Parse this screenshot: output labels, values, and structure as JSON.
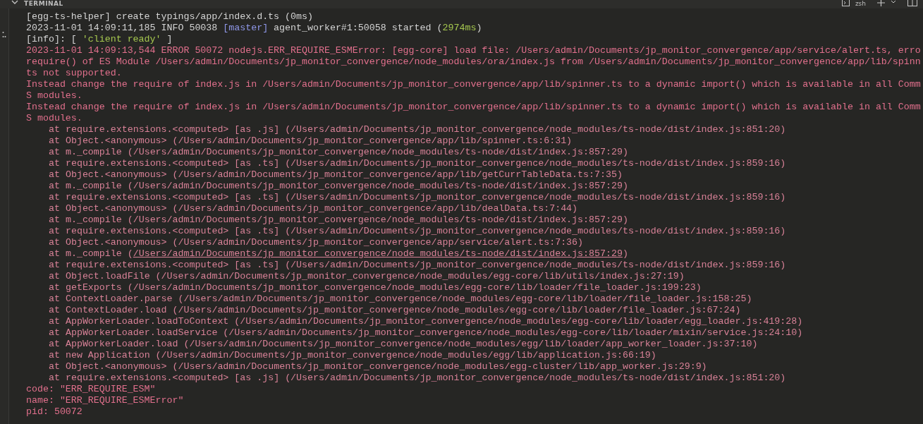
{
  "panel": {
    "title": "TERMINAL",
    "shell": "zsh"
  },
  "lines": [
    {
      "kind": "info",
      "text": "[egg-ts-helper] create typings/app/index.d.ts (0ms)"
    },
    {
      "kind": "info",
      "parts": [
        {
          "kind": "plain",
          "text": "2023-11-01 14:09:11,185 INFO 50038 "
        },
        {
          "kind": "blue",
          "text": "[master]"
        },
        {
          "kind": "plain",
          "text": " agent_worker#1:50058 started ("
        },
        {
          "kind": "green",
          "text": "2974ms"
        },
        {
          "kind": "plain",
          "text": ")"
        }
      ]
    },
    {
      "kind": "info",
      "parts": [
        {
          "kind": "plain",
          "text": "[info]: [ "
        },
        {
          "kind": "green",
          "text": "'client ready'"
        },
        {
          "kind": "plain",
          "text": " ]"
        }
      ]
    },
    {
      "kind": "error",
      "text": "2023-11-01 14:09:13,544 ERROR 50072 nodejs.ERR_REQUIRE_ESMError: [egg-core] load file: /Users/admin/Documents/jp_monitor_convergence/app/service/alert.ts, erro"
    },
    {
      "kind": "error",
      "text": "require() of ES Module /Users/admin/Documents/jp_monitor_convergence/node_modules/ora/index.js from /Users/admin/Documents/jp_monitor_convergence/app/lib/spinn"
    },
    {
      "kind": "error",
      "text": "ts not supported."
    },
    {
      "kind": "error",
      "text": "Instead change the require of index.js in /Users/admin/Documents/jp_monitor_convergence/app/lib/spinner.ts to a dynamic import() which is available in all Comm"
    },
    {
      "kind": "error",
      "text": "S modules."
    },
    {
      "kind": "error",
      "text": "Instead change the require of index.js in /Users/admin/Documents/jp_monitor_convergence/app/lib/spinner.ts to a dynamic import() which is available in all Comm"
    },
    {
      "kind": "error",
      "text": "S modules."
    },
    {
      "kind": "stack",
      "text": "at require.extensions.<computed> [as .js] (/Users/admin/Documents/jp_monitor_convergence/node_modules/ts-node/dist/index.js:851:20)"
    },
    {
      "kind": "stack",
      "text": "at Object.<anonymous> (/Users/admin/Documents/jp_monitor_convergence/app/lib/spinner.ts:6:31)"
    },
    {
      "kind": "stack",
      "text": "at m._compile (/Users/admin/Documents/jp_monitor_convergence/node_modules/ts-node/dist/index.js:857:29)"
    },
    {
      "kind": "stack",
      "text": "at require.extensions.<computed> [as .ts] (/Users/admin/Documents/jp_monitor_convergence/node_modules/ts-node/dist/index.js:859:16)"
    },
    {
      "kind": "stack",
      "text": "at Object.<anonymous> (/Users/admin/Documents/jp_monitor_convergence/app/lib/getCurrTableData.ts:7:35)"
    },
    {
      "kind": "stack",
      "text": "at m._compile (/Users/admin/Documents/jp_monitor_convergence/node_modules/ts-node/dist/index.js:857:29)"
    },
    {
      "kind": "stack",
      "text": "at require.extensions.<computed> [as .ts] (/Users/admin/Documents/jp_monitor_convergence/node_modules/ts-node/dist/index.js:859:16)"
    },
    {
      "kind": "stack",
      "text": "at Object.<anonymous> (/Users/admin/Documents/jp_monitor_convergence/app/lib/dealData.ts:7:44)"
    },
    {
      "kind": "stack",
      "text": "at m._compile (/Users/admin/Documents/jp_monitor_convergence/node_modules/ts-node/dist/index.js:857:29)"
    },
    {
      "kind": "stack",
      "text": "at require.extensions.<computed> [as .ts] (/Users/admin/Documents/jp_monitor_convergence/node_modules/ts-node/dist/index.js:859:16)"
    },
    {
      "kind": "stack",
      "text": "at Object.<anonymous> (/Users/admin/Documents/jp_monitor_convergence/app/service/alert.ts:7:36)"
    },
    {
      "kind": "stack",
      "parts": [
        {
          "kind": "plain",
          "text": "at m._compile ("
        },
        {
          "kind": "link",
          "text": "/Users/admin/Documents/jp_monitor_convergence/node_modules/ts-node/dist/index.js:857:29"
        },
        {
          "kind": "plain",
          "text": ")"
        }
      ]
    },
    {
      "kind": "stack",
      "text": "at require.extensions.<computed> [as .ts] (/Users/admin/Documents/jp_monitor_convergence/node_modules/ts-node/dist/index.js:859:16)"
    },
    {
      "kind": "stack",
      "text": "at Object.loadFile (/Users/admin/Documents/jp_monitor_convergence/node_modules/egg-core/lib/utils/index.js:27:19)"
    },
    {
      "kind": "stack",
      "text": "at getExports (/Users/admin/Documents/jp_monitor_convergence/node_modules/egg-core/lib/loader/file_loader.js:199:23)"
    },
    {
      "kind": "stack",
      "text": "at ContextLoader.parse (/Users/admin/Documents/jp_monitor_convergence/node_modules/egg-core/lib/loader/file_loader.js:158:25)"
    },
    {
      "kind": "stack",
      "text": "at ContextLoader.load (/Users/admin/Documents/jp_monitor_convergence/node_modules/egg-core/lib/loader/file_loader.js:67:24)"
    },
    {
      "kind": "stack",
      "text": "at AppWorkerLoader.loadToContext (/Users/admin/Documents/jp_monitor_convergence/node_modules/egg-core/lib/loader/egg_loader.js:419:28)"
    },
    {
      "kind": "stack",
      "text": "at AppWorkerLoader.loadService (/Users/admin/Documents/jp_monitor_convergence/node_modules/egg-core/lib/loader/mixin/service.js:24:10)"
    },
    {
      "kind": "stack",
      "text": "at AppWorkerLoader.load (/Users/admin/Documents/jp_monitor_convergence/node_modules/egg/lib/loader/app_worker_loader.js:37:10)"
    },
    {
      "kind": "stack",
      "text": "at new Application (/Users/admin/Documents/jp_monitor_convergence/node_modules/egg/lib/application.js:66:19)"
    },
    {
      "kind": "stack",
      "text": "at Object.<anonymous> (/Users/admin/Documents/jp_monitor_convergence/node_modules/egg-cluster/lib/app_worker.js:29:9)"
    },
    {
      "kind": "stack",
      "text": "at require.extensions.<computed> [as .js] (/Users/admin/Documents/jp_monitor_convergence/node_modules/ts-node/dist/index.js:851:20)"
    },
    {
      "kind": "error",
      "text": "code: \"ERR_REQUIRE_ESM\""
    },
    {
      "kind": "error",
      "text": "name: \"ERR_REQUIRE_ESMError\""
    },
    {
      "kind": "error",
      "text": "pid: 50072"
    }
  ]
}
